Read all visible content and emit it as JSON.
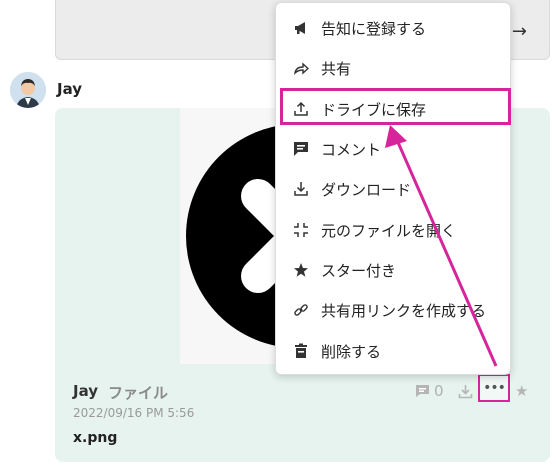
{
  "author": "Jay",
  "file": {
    "author": "Jay",
    "type": "ファイル",
    "timestamp": "2022/09/16 PM 5:56",
    "name": "x.png",
    "comment_count": "0"
  },
  "menu": {
    "items": [
      {
        "label": "告知に登録する",
        "icon": "megaphone-icon"
      },
      {
        "label": "共有",
        "icon": "share-arrow-icon"
      },
      {
        "label": "ドライブに保存",
        "icon": "upload-icon"
      },
      {
        "label": "コメント",
        "icon": "comment-icon"
      },
      {
        "label": "ダウンロード",
        "icon": "download-icon"
      },
      {
        "label": "元のファイルを開く",
        "icon": "expand-icon"
      },
      {
        "label": "スター付き",
        "icon": "star-icon"
      },
      {
        "label": "共有用リンクを作成する",
        "icon": "link-icon"
      },
      {
        "label": "削除する",
        "icon": "trash-icon"
      }
    ]
  },
  "colors": {
    "highlight": "#d6249b",
    "card_bg": "#e6f3ef"
  }
}
